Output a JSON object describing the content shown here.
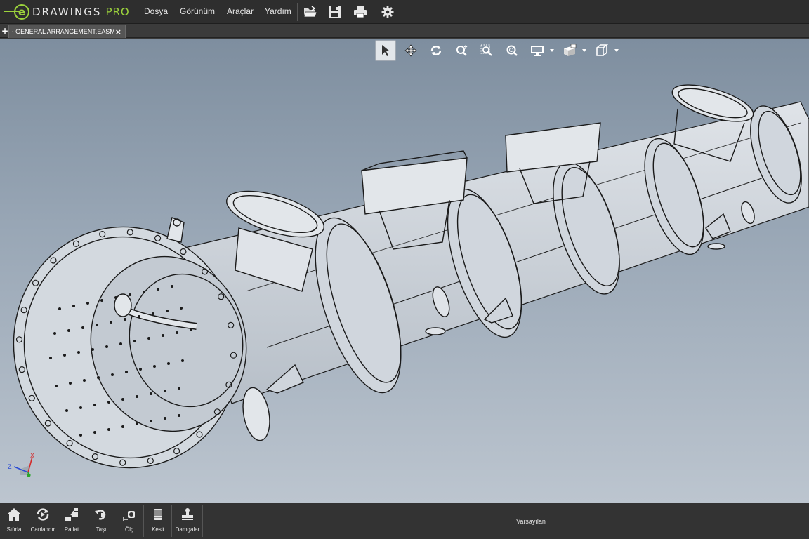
{
  "app": {
    "logo_word": "DRAWINGS",
    "logo_edition": "PRO",
    "logo_trademark": "®"
  },
  "menu": {
    "items": [
      {
        "label": "Dosya"
      },
      {
        "label": "Görünüm"
      },
      {
        "label": "Araçlar"
      },
      {
        "label": "Yardım"
      }
    ]
  },
  "top_toolbar": {
    "icons": [
      "open-folder-icon",
      "save-icon",
      "print-icon",
      "settings-gear-icon"
    ]
  },
  "tabs": {
    "add_symbol": "+",
    "documents": [
      {
        "label": "GENERAL ARRANGEMENT.EASM",
        "close_symbol": "×",
        "icon": "assembly-icon"
      }
    ]
  },
  "view_toolbar": {
    "tools": [
      {
        "name": "select-tool",
        "icon": "cursor-arrow-icon",
        "active": true
      },
      {
        "name": "pan-tool",
        "icon": "move-arrows-icon"
      },
      {
        "name": "rotate-tool",
        "icon": "rotate-icon"
      },
      {
        "name": "zoom-tool",
        "icon": "zoom-icon"
      },
      {
        "name": "zoom-to-area-tool",
        "icon": "zoom-area-icon"
      },
      {
        "name": "zoom-to-fit-tool",
        "icon": "zoom-fit-icon"
      },
      {
        "name": "display-style-tool",
        "icon": "monitor-icon",
        "dropdown": true
      },
      {
        "name": "standard-views-tool",
        "icon": "views-icon",
        "dropdown": true
      },
      {
        "name": "view-orientation-tool",
        "icon": "cube-icon",
        "dropdown": true
      }
    ]
  },
  "triad": {
    "x_label": "X",
    "z_label": "Z",
    "x_color": "#d42a2a",
    "y_color": "#2aa52a",
    "z_color": "#2a4ad4"
  },
  "bottom_bar": {
    "buttons": [
      {
        "label": "Sıfırla",
        "icon": "home-reset-icon"
      },
      {
        "label": "Canlandır",
        "icon": "animate-icon"
      },
      {
        "label": "Patlat",
        "icon": "explode-icon"
      },
      {
        "label": "Taşı",
        "icon": "move-component-icon"
      },
      {
        "label": "Ölç",
        "icon": "measure-icon"
      },
      {
        "label": "Kesit",
        "icon": "section-icon"
      },
      {
        "label": "Damgalar",
        "icon": "stamp-icon"
      }
    ],
    "configuration": "Varsayılan"
  },
  "colors": {
    "accent": "#9cd33c",
    "toolbar_bg": "#2e2e2e",
    "viewport_top": "#7e8e9f",
    "viewport_bottom": "#bcc5cf",
    "model_fill": "#cdd3da",
    "model_line": "#1a1a1a"
  }
}
